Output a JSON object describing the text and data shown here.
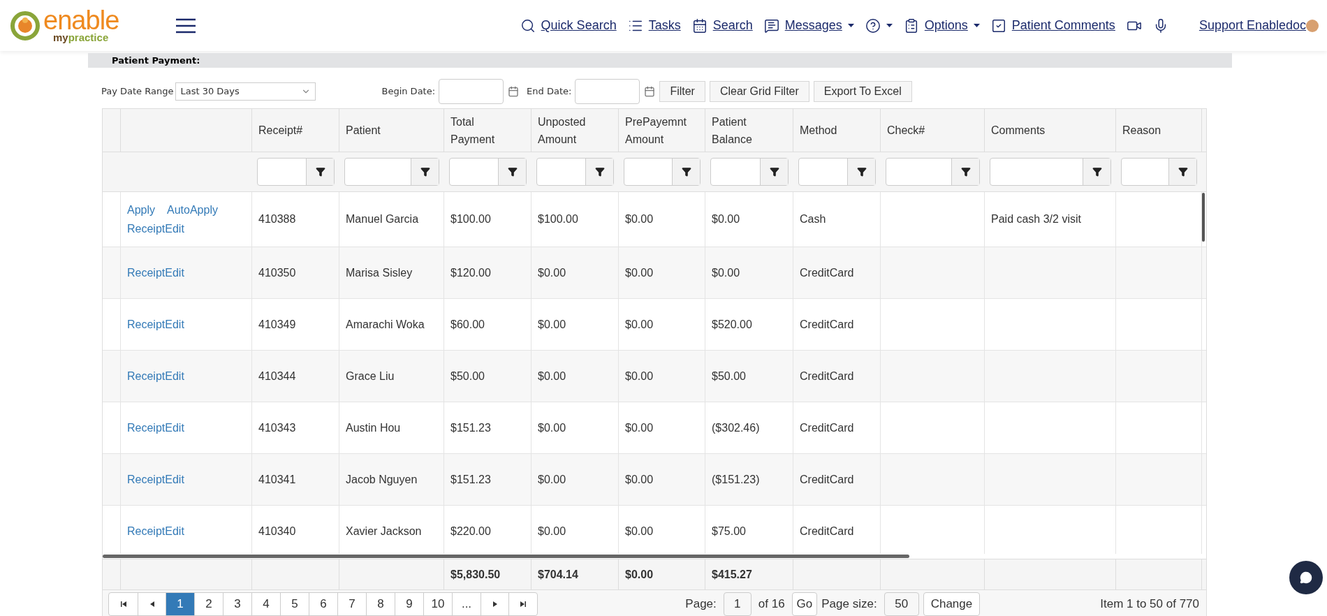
{
  "nav": {
    "items": [
      {
        "kind": "search",
        "label": "Quick Search",
        "dropdown": false
      },
      {
        "kind": "tasks",
        "label": "Tasks",
        "dropdown": false
      },
      {
        "kind": "calendar",
        "label": "Search",
        "dropdown": false
      },
      {
        "kind": "messages",
        "label": "Messages",
        "dropdown": true
      },
      {
        "kind": "help",
        "dropdown": true
      },
      {
        "kind": "options",
        "label": "Options",
        "dropdown": true
      },
      {
        "kind": "comments",
        "label": "Patient Comments",
        "dropdown": false
      },
      {
        "kind": "video",
        "dropdown": false
      },
      {
        "kind": "mic",
        "dropdown": false
      }
    ],
    "user": "Support Enabledoc"
  },
  "logo": {
    "top": "enable",
    "bottom_a": "my",
    "bottom_b": "practice"
  },
  "section_title": "Patient Payment:",
  "toolbar": {
    "range_label": "Pay Date Range",
    "range_value": "Last 30 Days",
    "begin_label": "Begin Date:",
    "end_label": "End Date:",
    "buttons": [
      "Filter",
      "Clear Grid Filter",
      "Export To Excel"
    ]
  },
  "table": {
    "columns": [
      "Receipt#",
      "Patient",
      "Total Payment",
      "Unposted Amount",
      "PrePayemnt Amount",
      "Patient Balance",
      "Method",
      "Check#",
      "Comments",
      "Reason"
    ],
    "rows": [
      {
        "actions": [
          "Apply",
          "AutoApply",
          "Receipt",
          "Edit"
        ],
        "cells": [
          "410388",
          "Manuel Garcia",
          "$100.00",
          "$100.00",
          "$0.00",
          "$0.00",
          "Cash",
          "",
          "Paid cash 3/2 visit",
          ""
        ]
      },
      {
        "actions": [
          "Receipt",
          "Edit"
        ],
        "cells": [
          "410350",
          "Marisa Sisley",
          "$120.00",
          "$0.00",
          "$0.00",
          "$0.00",
          "CreditCard",
          "",
          "",
          ""
        ]
      },
      {
        "actions": [
          "Receipt",
          "Edit"
        ],
        "cells": [
          "410349",
          "Amarachi Woka",
          "$60.00",
          "$0.00",
          "$0.00",
          "$520.00",
          "CreditCard",
          "",
          "",
          ""
        ]
      },
      {
        "actions": [
          "Receipt",
          "Edit"
        ],
        "cells": [
          "410344",
          "Grace Liu",
          "$50.00",
          "$0.00",
          "$0.00",
          "$50.00",
          "CreditCard",
          "",
          "",
          ""
        ]
      },
      {
        "actions": [
          "Receipt",
          "Edit"
        ],
        "cells": [
          "410343",
          "Austin Hou",
          "$151.23",
          "$0.00",
          "$0.00",
          "($302.46)",
          "CreditCard",
          "",
          "",
          ""
        ]
      },
      {
        "actions": [
          "Receipt",
          "Edit"
        ],
        "cells": [
          "410341",
          "Jacob Nguyen",
          "$151.23",
          "$0.00",
          "$0.00",
          "($151.23)",
          "CreditCard",
          "",
          "",
          ""
        ]
      },
      {
        "actions": [
          "Receipt",
          "Edit"
        ],
        "cells": [
          "410340",
          "Xavier Jackson",
          "$220.00",
          "$0.00",
          "$0.00",
          "$75.00",
          "CreditCard",
          "",
          "",
          ""
        ]
      }
    ],
    "totals": {
      "total_payment": "$5,830.50",
      "unposted_amount": "$704.14",
      "prepayment_amount": "$0.00",
      "patient_balance": "$415.27"
    }
  },
  "pager": {
    "pages": [
      {
        "label": "1",
        "selected": true
      },
      {
        "label": "2",
        "selected": false
      },
      {
        "label": "3",
        "selected": false
      },
      {
        "label": "4",
        "selected": false
      },
      {
        "label": "5",
        "selected": false
      },
      {
        "label": "6",
        "selected": false
      },
      {
        "label": "7",
        "selected": false
      },
      {
        "label": "8",
        "selected": false
      },
      {
        "label": "9",
        "selected": false
      },
      {
        "label": "10",
        "selected": false
      },
      {
        "label": "...",
        "selected": false
      }
    ],
    "page_label": "Page:",
    "page_value": "1",
    "of": "of 16",
    "go": "Go",
    "size_label": "Page size:",
    "size_value": "50",
    "change": "Change",
    "info": "Item 1 to 50 of 770"
  }
}
